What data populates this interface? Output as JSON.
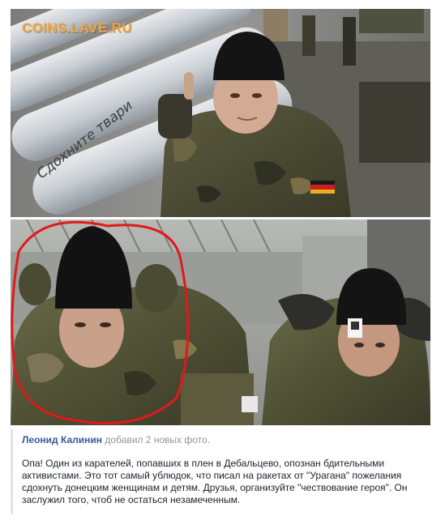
{
  "watermark": "COINS.LAVE.RU",
  "post": {
    "author": "Леонид Калинин",
    "action": "добавил 2 новых фото.",
    "text": "Опа! Один из карателей, попавших в плен в Дебальцево, опознан бдительными активистами. Это тот самый ублюдок, что писал на ракетах от \"Урагана\" пожелания сдохнуть донецким женщинам и детям. Друзья, организуйте \"чествование героя\". Он заслужил того, чтоб не остаться незамеченным."
  },
  "photos": {
    "top": {
      "missile_inscription": "Сдохните твари"
    }
  },
  "colors": {
    "watermark": "#f2a33a",
    "author_link": "#365899",
    "action_text": "#90949c",
    "body_text": "#1d2129",
    "highlight_circle": "#e0191b"
  }
}
